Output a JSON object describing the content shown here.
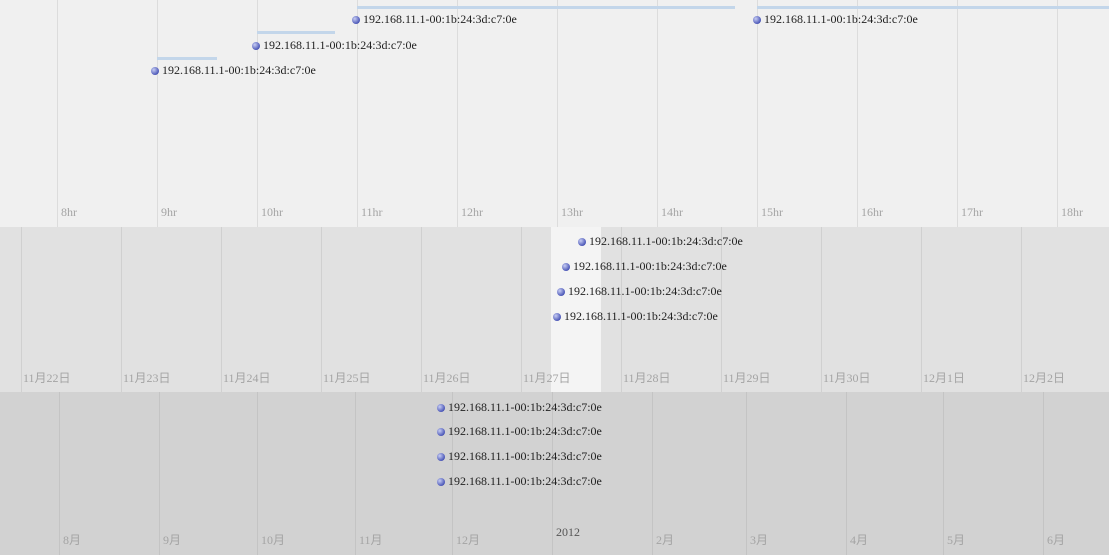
{
  "hour_band": {
    "ticks": [
      "8hr",
      "9hr",
      "10hr",
      "11hr",
      "12hr",
      "13hr",
      "14hr",
      "15hr",
      "16hr",
      "17hr",
      "18hr"
    ],
    "events": [
      "192.168.11.1-00:1b:24:3d:c7:0e",
      "192.168.11.1-00:1b:24:3d:c7:0e",
      "192.168.11.1-00:1b:24:3d:c7:0e",
      "192.168.11.1-00:1b:24:3d:c7:0e"
    ]
  },
  "day_band": {
    "ticks": [
      "11月22日",
      "11月23日",
      "11月24日",
      "11月25日",
      "11月26日",
      "11月27日",
      "11月28日",
      "11月29日",
      "11月30日",
      "12月1日",
      "12月2日"
    ],
    "events": [
      "192.168.11.1-00:1b:24:3d:c7:0e",
      "192.168.11.1-00:1b:24:3d:c7:0e",
      "192.168.11.1-00:1b:24:3d:c7:0e",
      "192.168.11.1-00:1b:24:3d:c7:0e"
    ]
  },
  "month_band": {
    "ticks": [
      "8月",
      "9月",
      "10月",
      "11月",
      "12月",
      "2012",
      "2月",
      "3月",
      "4月",
      "5月",
      "6月"
    ],
    "events": [
      "192.168.11.1-00:1b:24:3d:c7:0e",
      "192.168.11.1-00:1b:24:3d:c7:0e",
      "192.168.11.1-00:1b:24:3d:c7:0e",
      "192.168.11.1-00:1b:24:3d:c7:0e"
    ]
  },
  "colors": {
    "event_dot": "#4b57b8",
    "duration": "#c3d6ea"
  }
}
